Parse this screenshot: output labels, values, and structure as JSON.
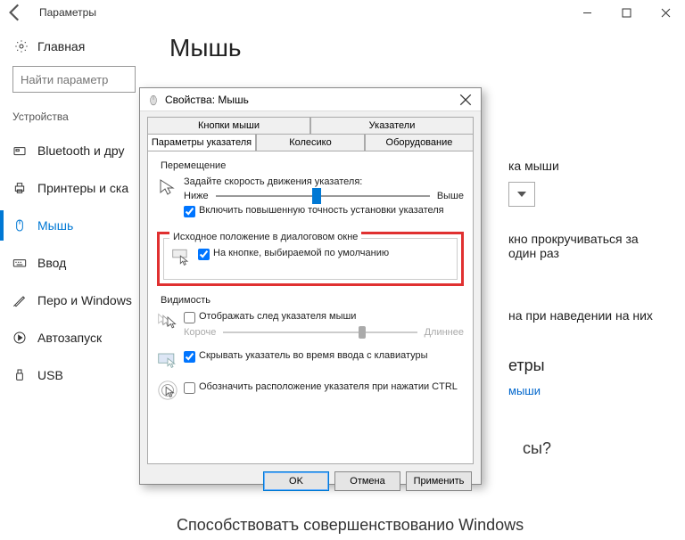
{
  "window": {
    "title": "Параметры",
    "minimize": "–",
    "maximize": "□",
    "close": "×"
  },
  "sidebar": {
    "home": "Главная",
    "search_placeholder": "Найти параметр",
    "category": "Устройства",
    "items": [
      {
        "label": "Bluetooth и дру"
      },
      {
        "label": "Принтеры и ска"
      },
      {
        "label": "Мышь"
      },
      {
        "label": "Ввод"
      },
      {
        "label": "Перо и Windows"
      },
      {
        "label": "Автозапуск"
      },
      {
        "label": "USB"
      }
    ]
  },
  "page": {
    "heading": "Мышь",
    "partial_1": "ка мыши",
    "partial_2": "кно прокручиваться за один раз",
    "partial_3": "на при наведении на них",
    "params_heading": "етры",
    "link": "мыши",
    "questions": "сы?",
    "footer": "Способствоватъ совершенствованио Windows"
  },
  "dialog": {
    "title": "Свойства: Мышь",
    "tabs": {
      "row1": [
        "Кнопки мыши",
        "Указатели"
      ],
      "row2": [
        "Параметры указателя",
        "Колесико",
        "Оборудование"
      ]
    },
    "groups": {
      "movement": {
        "label": "Перемещение",
        "speed_label": "Задайте скорость движения указателя:",
        "slow": "Ниже",
        "fast": "Выше",
        "enhance": "Включить повышенную точность установки указателя"
      },
      "snap": {
        "label": "Исходное положение в диалоговом окне",
        "option": "На кнопке, выбираемой по умолчанию"
      },
      "visibility": {
        "label": "Видимость",
        "trails": "Отображать след указателя мыши",
        "short": "Короче",
        "long": "Длиннее",
        "hide_typing": "Скрывать указатель во время ввода с клавиатуры",
        "ctrl": "Обозначить расположение указателя при нажатии CTRL"
      }
    },
    "buttons": {
      "ok": "OK",
      "cancel": "Отмена",
      "apply": "Применить"
    }
  }
}
